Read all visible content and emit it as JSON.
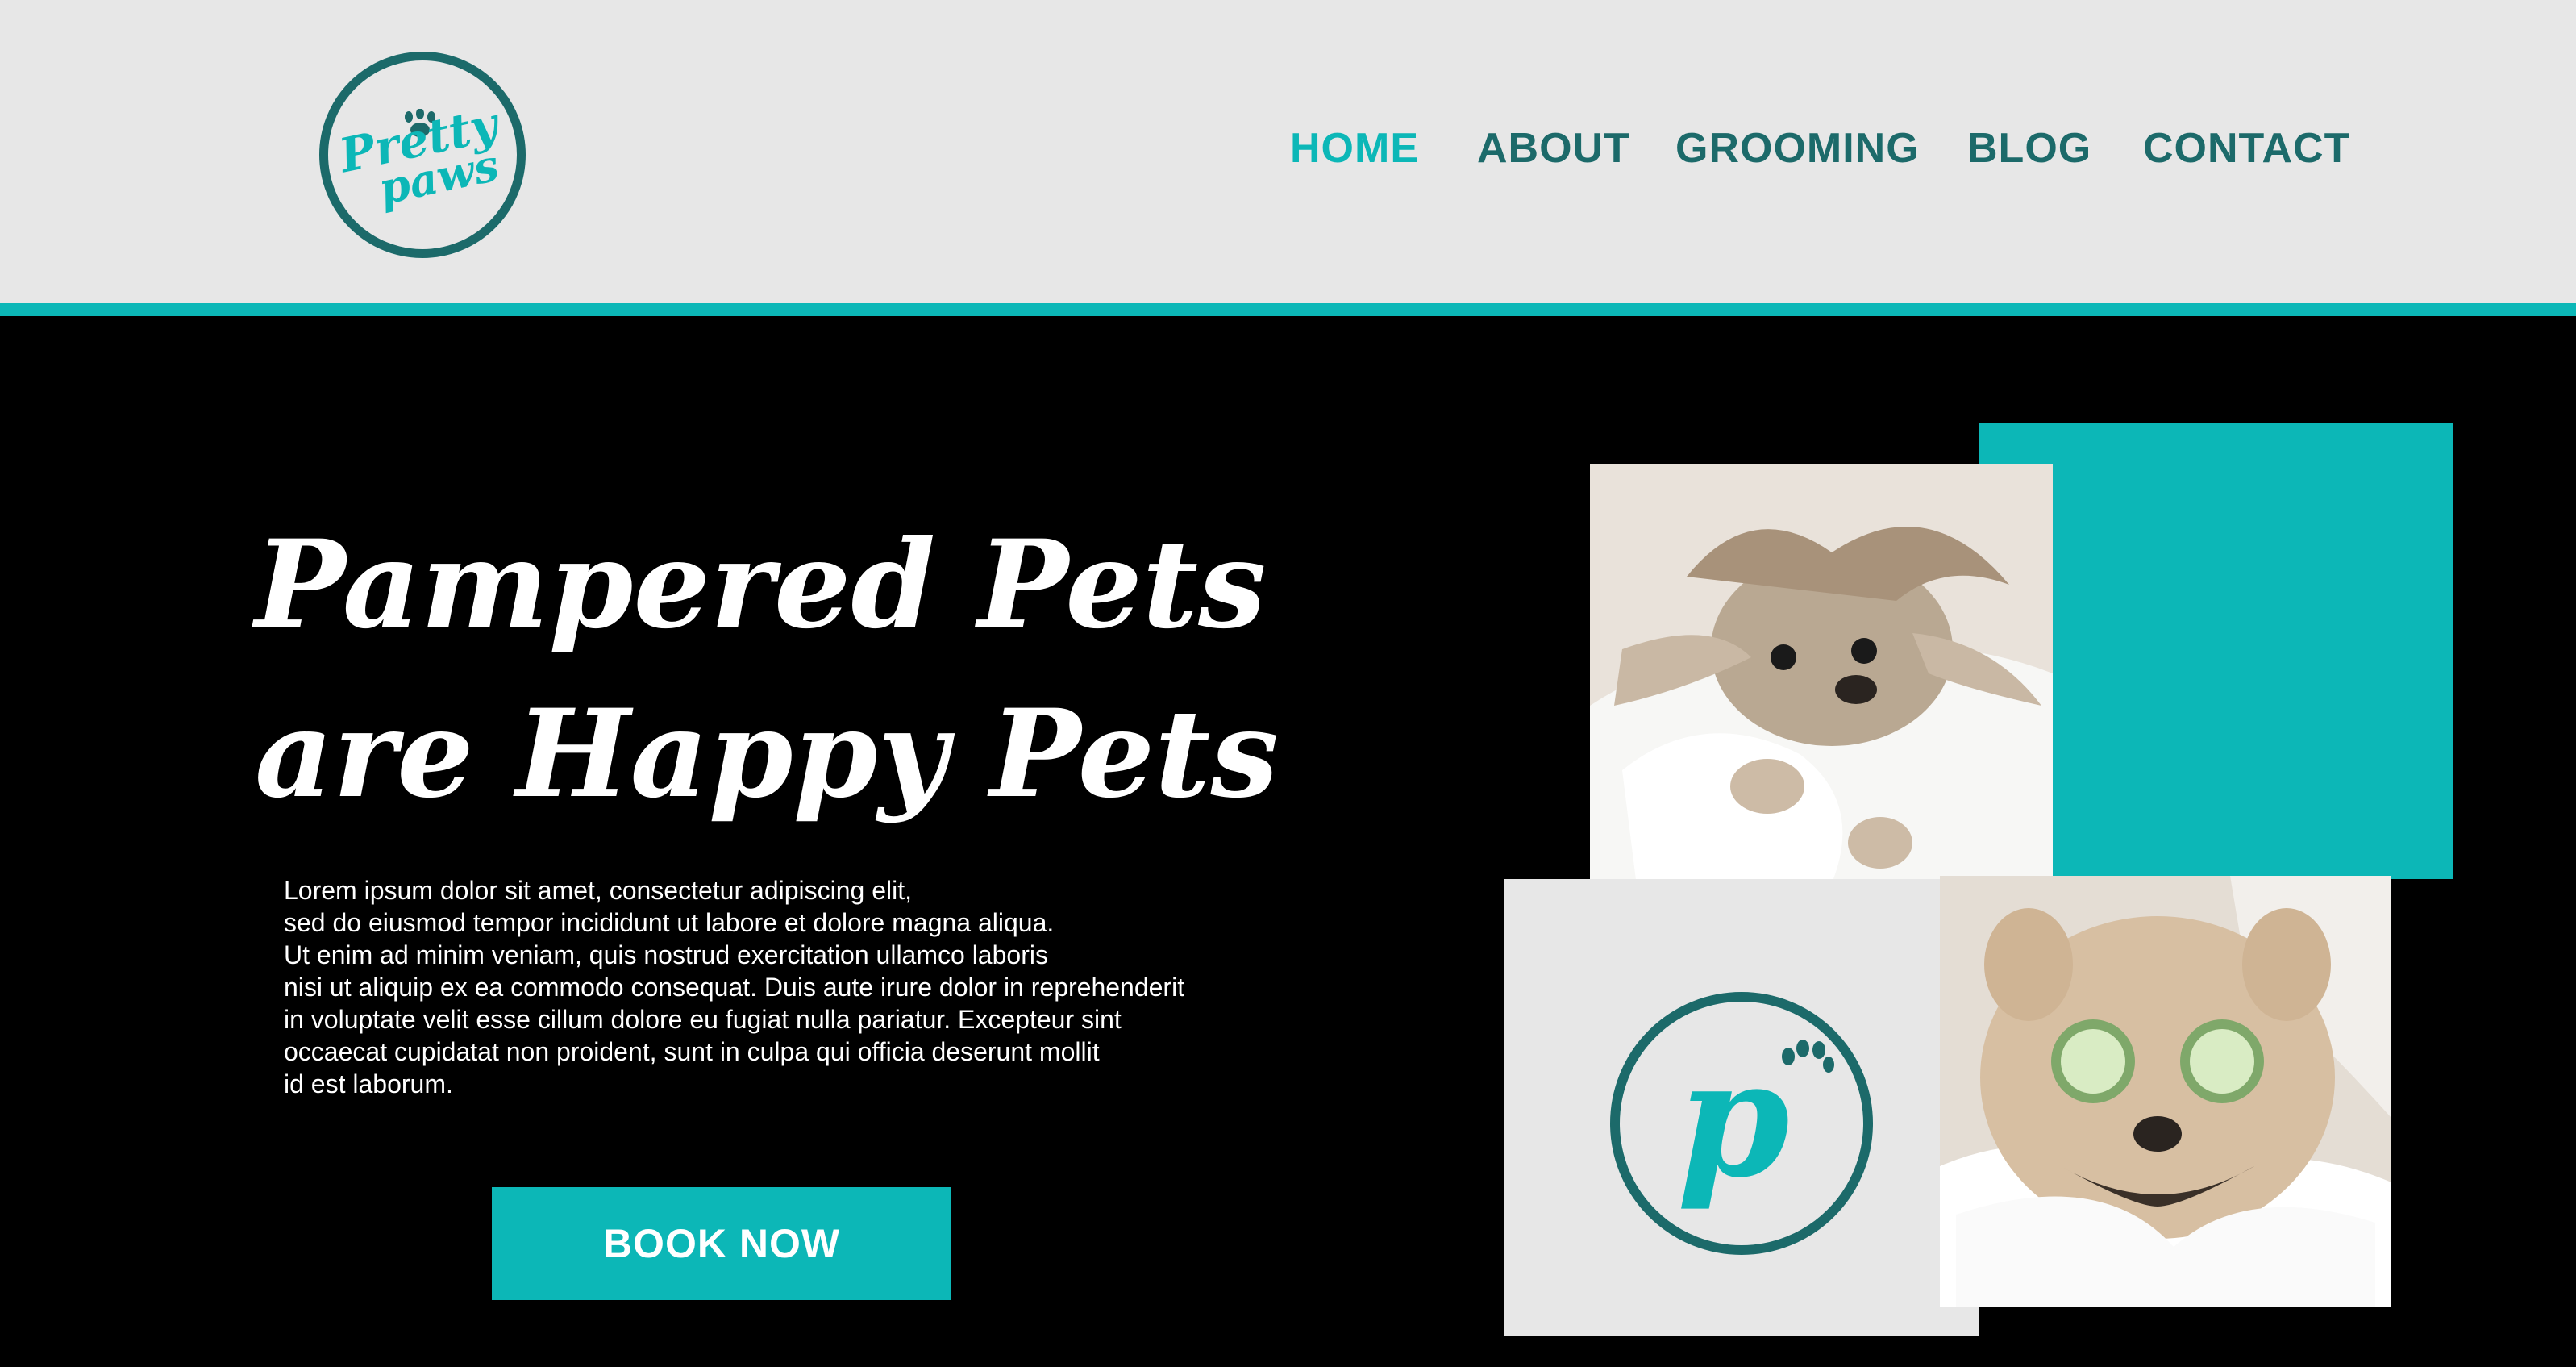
{
  "brand": {
    "logo_line1": "Pretty",
    "logo_line2": "paws",
    "logo_letter": "p"
  },
  "nav": {
    "items": [
      {
        "label": "HOME",
        "active": true
      },
      {
        "label": "ABOUT",
        "active": false
      },
      {
        "label": "GROOMING",
        "active": false
      },
      {
        "label": "BLOG",
        "active": false
      },
      {
        "label": "CONTACT",
        "active": false
      }
    ]
  },
  "hero": {
    "title_line1": "Pampered Pets",
    "title_line2": "are Happy Pets",
    "body_lines": [
      "Lorem ipsum dolor sit amet, consectetur adipiscing elit,",
      "sed do eiusmod tempor incididunt ut labore et dolore magna aliqua.",
      "Ut enim ad minim veniam, quis nostrud exercitation ullamco laboris",
      "nisi ut aliquip ex ea commodo consequat. Duis aute irure dolor in reprehenderit",
      "in voluptate velit esse cillum dolore eu fugiat nulla pariatur. Excepteur sint",
      "occaecat cupidatat non proident, sunt in culpa qui officia deserunt mollit",
      "id est laborum."
    ],
    "cta_label": "BOOK NOW"
  },
  "colors": {
    "teal": "#0cb7b7",
    "dark_teal": "#1c6a6a",
    "light_gray": "#e7e7e7",
    "background": "#000000"
  },
  "icons": {
    "logo_paw": "paw-icon",
    "tile_paw": "paw-icon"
  }
}
